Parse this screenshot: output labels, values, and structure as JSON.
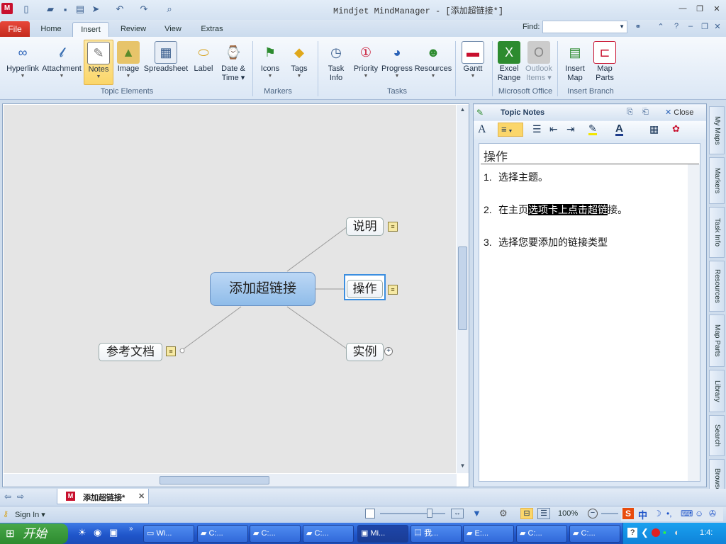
{
  "title": "Mindjet MindManager - [添加超链接*]",
  "tabs": [
    "File",
    "Home",
    "Insert",
    "Review",
    "View",
    "Extras"
  ],
  "active_tab": "Insert",
  "find_label": "Find:",
  "ribbon": {
    "buttons": [
      {
        "label": "Hyperlink",
        "icon": "hyperlink-icon"
      },
      {
        "label": "Attachment",
        "icon": "paperclip-icon"
      },
      {
        "label": "Notes",
        "icon": "notes-icon",
        "selected": true
      },
      {
        "label": "Image",
        "icon": "image-icon"
      },
      {
        "label": "Spreadsheet",
        "icon": "spreadsheet-icon"
      },
      {
        "label": "Label",
        "icon": "label-icon"
      },
      {
        "label": "Date &",
        "label2": "Time",
        "icon": "calendar-icon"
      },
      {
        "label": "Icons",
        "icon": "flag-icon"
      },
      {
        "label": "Tags",
        "icon": "tag-icon"
      },
      {
        "label": "Task",
        "label2": "Info",
        "icon": "task-info-icon"
      },
      {
        "label": "Priority",
        "icon": "priority-icon"
      },
      {
        "label": "Progress",
        "icon": "progress-icon"
      },
      {
        "label": "Resources",
        "icon": "person-icon"
      },
      {
        "label": "Gantt",
        "icon": "gantt-icon"
      },
      {
        "label": "Excel",
        "label2": "Range",
        "icon": "excel-icon"
      },
      {
        "label": "Outlook",
        "label2": "Items",
        "icon": "outlook-icon",
        "disabled": true
      },
      {
        "label": "Insert",
        "label2": "Map",
        "icon": "insert-map-icon"
      },
      {
        "label": "Map",
        "label2": "Parts",
        "icon": "map-parts-icon"
      }
    ],
    "groups": [
      "Topic Elements",
      "Markers",
      "Tasks",
      "Microsoft Office",
      "Insert Branch"
    ]
  },
  "map": {
    "central": "添加超链接",
    "topics": [
      "说明",
      "操作",
      "实例",
      "参考文档"
    ]
  },
  "notes": {
    "header": "Topic Notes",
    "close": "Close",
    "topic_title": "操作",
    "steps": [
      {
        "num": "1.",
        "text": "选择主题。"
      },
      {
        "num": "2.",
        "pre": "在主页",
        "hl": "选项卡上点击超链",
        "post": "接。"
      },
      {
        "num": "3.",
        "text": "选择您要添加的链接类型"
      }
    ]
  },
  "side_tabs": [
    "My Maps",
    "Markers",
    "Task Info",
    "Resources",
    "Map Parts",
    "Library",
    "Search",
    "Browser"
  ],
  "doc_tab": "添加超链接*",
  "status": {
    "sign_in": "Sign In",
    "zoom": "100%"
  },
  "taskbar": {
    "start": "开始",
    "items": [
      "Wi...",
      "C:...",
      "C:...",
      "C:...",
      "Mi...",
      "我...",
      "E:...",
      "C:...",
      "C:..."
    ],
    "clock": "1:4:"
  }
}
